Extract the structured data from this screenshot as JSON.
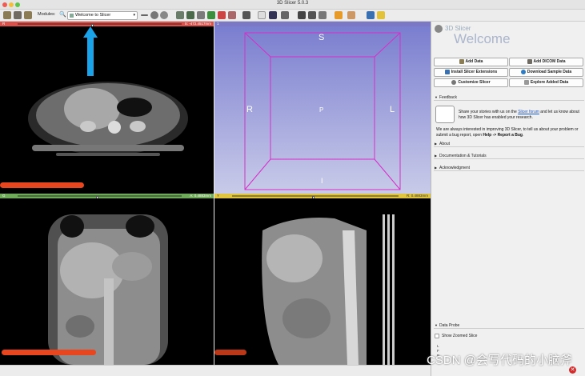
{
  "window": {
    "title": "3D Slicer 5.0.3"
  },
  "toolbar": {
    "modules_label": "Modules:",
    "current_module": "Welcome to Slicer"
  },
  "views": {
    "red": {
      "label": "R",
      "value": "S: -472.4517mm",
      "color": "#d8524b"
    },
    "threed": {
      "label": "1",
      "color": "#7b78c6",
      "orientation": {
        "top": "S",
        "left": "R",
        "center": "P",
        "right": "L",
        "bottom": "I"
      }
    },
    "green": {
      "label": "G",
      "value": "A: 0.4883mm",
      "color": "#6fa95a"
    },
    "yellow": {
      "label": "Y",
      "value": "R: 0.4883mm",
      "color": "#e0c640"
    }
  },
  "panel": {
    "app_name": "3D Slicer",
    "welcome_title": "Welcome",
    "buttons": {
      "add_data": "Add Data",
      "add_dicom": "Add DICOM Data",
      "install_ext": "Install Slicer Extensions",
      "download_sample": "Download Sample Data",
      "customize": "Customize Slicer",
      "explore": "Explore Added Data"
    },
    "sections": {
      "feedback": "Feedback",
      "about": "About",
      "docs": "Documentation & Tutorials",
      "ack": "Acknowledgment",
      "data_probe": "Data Probe"
    },
    "feedback_text1": "Share your stories with us on the",
    "feedback_link": "Slicer forum",
    "feedback_text2": "and let us know about how 3D Slicer has enabled your research.",
    "feedback_text3": "We are always interested in improving 3D Slicer, to tell us about your problem or submit a bug report, open",
    "feedback_help": "Help -> Report a Bug",
    "show_zoomed": "Show Zoomed Slice",
    "probe_lines": [
      "L",
      "F",
      "B"
    ]
  },
  "watermark": "CSDN @会写代码的小脑斧"
}
